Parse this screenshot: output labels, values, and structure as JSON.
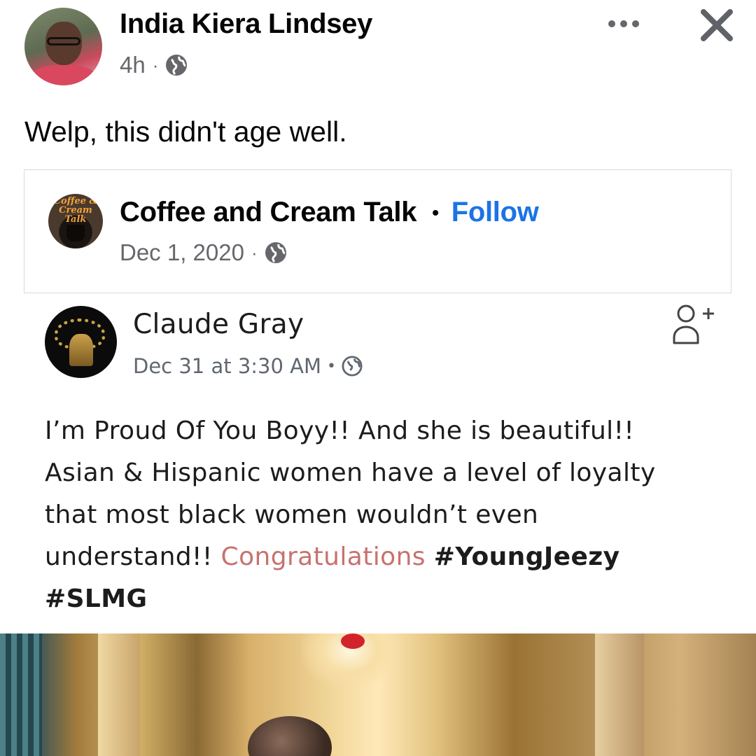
{
  "post": {
    "author": "India Kiera Lindsey",
    "time": "4h",
    "separator": "·",
    "privacy_icon": "globe-icon",
    "caption": "Welp, this didn't age well."
  },
  "toolbar": {
    "more_icon": "more-options-icon",
    "close_icon": "close-icon"
  },
  "shared": {
    "page_name": "Coffee and Cream Talk",
    "dot": "•",
    "follow_label": "Follow",
    "date": "Dec 1, 2020",
    "separator": "·",
    "avatar_logo_text": "Coffee & Cream Talk",
    "accent_color": "#1b74e4"
  },
  "inner_post": {
    "author": "Claude Gray",
    "timestamp": "Dec 31 at 3:30 AM",
    "separator": "•",
    "add_friend_icon": "add-friend-icon",
    "text_line1": "I’m Proud Of You Boyy!! And she is beautiful!!",
    "text_line2": "Asian & Hispanic women have a level of loyalty",
    "text_line3": "that most black women wouldn’t even",
    "text_line4_start": "understand!! ",
    "text_highlight": "Congratulations",
    "hashtag1": "#YoungJeezy",
    "hashtag2": "#SLMG",
    "highlight_color": "#c8726e"
  }
}
